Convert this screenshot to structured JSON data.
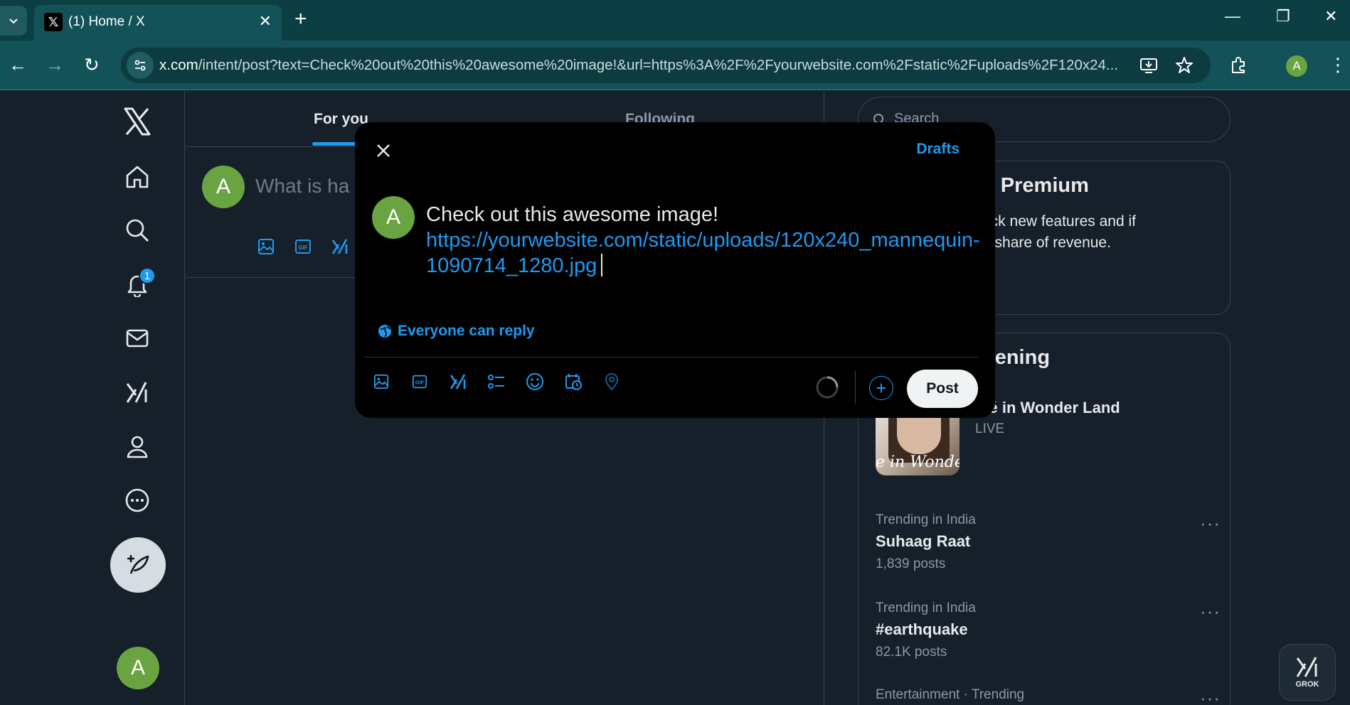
{
  "browser": {
    "tab_title": "(1) Home / X",
    "url_host": "x.com",
    "url_path": "/intent/post?text=Check%20out%20this%20awesome%20image!&url=https%3A%2F%2Fyourwebsite.com%2Fstatic%2Fuploads%2F120x24...",
    "profile_initial": "A"
  },
  "nav": {
    "notification_count": "1",
    "avatar_initial": "A"
  },
  "feed": {
    "tab_for_you": "For you",
    "tab_following": "Following",
    "composer_placeholder": "What is ha",
    "composer_avatar_initial": "A"
  },
  "right": {
    "search_placeholder": "Search",
    "premium_title": "o Premium",
    "premium_desc_line1": "ock new features and if",
    "premium_desc_line2": "a share of revenue.",
    "happening_title": "pening",
    "event": {
      "title": "loé in Wonder Land",
      "status": "LIVE",
      "image_caption": "e in Wonder l"
    },
    "trends": [
      {
        "category": "Trending in India",
        "name": "Suhaag Raat",
        "count": "1,839 posts"
      },
      {
        "category": "Trending in India",
        "name": "#earthquake",
        "count": "82.1K posts"
      },
      {
        "category": "Entertainment · Trending",
        "name": "",
        "count": ""
      }
    ],
    "grok_label": "GROK"
  },
  "modal": {
    "drafts_label": "Drafts",
    "avatar_initial": "A",
    "text": "Check out this awesome image!",
    "link": "https://yourwebsite.com/static/uploads/120x240_mannequin-1090714_1280.jpg",
    "reply_setting": "Everyone can reply",
    "post_button": "Post"
  },
  "colors": {
    "accent": "#1d9bf0",
    "background": "#15202b",
    "modal_bg": "#000000",
    "avatar": "#6aa442",
    "chrome": "#0b3f44"
  }
}
